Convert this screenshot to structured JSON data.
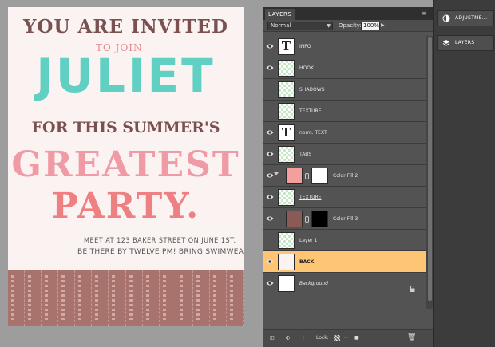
{
  "poster": {
    "line1": "YOU ARE INVITED",
    "line2": "TO JOIN",
    "line3": "JULIET",
    "line4": "FOR THIS SUMMER'S",
    "line5": "GREATEST",
    "line6": "PARTY.",
    "info1": "MEET AT 123 BAKER STREET ON JUNE 1ST.",
    "info2": "BE THERE BY TWELVE PM! BRING SWIMWEAR.",
    "colors": {
      "brown": "#7a5050",
      "teal": "#5fd0c2",
      "pink": "#ef9aa4",
      "coral": "#ee7f82",
      "tabs": "#a7736c"
    }
  },
  "layers_panel": {
    "title": "LAYERS",
    "menu_icon": "panel-menu-icon",
    "blend_mode": "Normal",
    "opacity_label": "Opacity:",
    "opacity_value": "100%",
    "layers": [
      {
        "name": "INFO",
        "thumb": "type"
      },
      {
        "name": "HOOK",
        "thumb": "checker"
      },
      {
        "name": "SHADOWS",
        "thumb": "checker"
      },
      {
        "name": "TEXTURE",
        "thumb": "checker"
      },
      {
        "name": "norm. TEXT",
        "thumb": "type"
      },
      {
        "name": "TABS",
        "thumb": "checker"
      },
      {
        "name": "Color Fill 2",
        "thumb": "fill-pink"
      },
      {
        "name": "TEXTURE",
        "thumb": "checker"
      },
      {
        "name": "Color Fill 3",
        "thumb": "fill-brown"
      },
      {
        "name": "Layer 1",
        "thumb": "checker"
      },
      {
        "name": "BACK",
        "thumb": "back",
        "selected": true
      },
      {
        "name": "Background",
        "thumb": "white",
        "locked": true
      }
    ],
    "bottom_bar": {
      "lock_label": "Lock:"
    },
    "selected_color": "#fdc574"
  },
  "dock": {
    "items": [
      {
        "label": "ADJUSTME...",
        "icon": "adjustments-icon"
      },
      {
        "label": "LAYERS",
        "icon": "layers-icon"
      }
    ]
  }
}
